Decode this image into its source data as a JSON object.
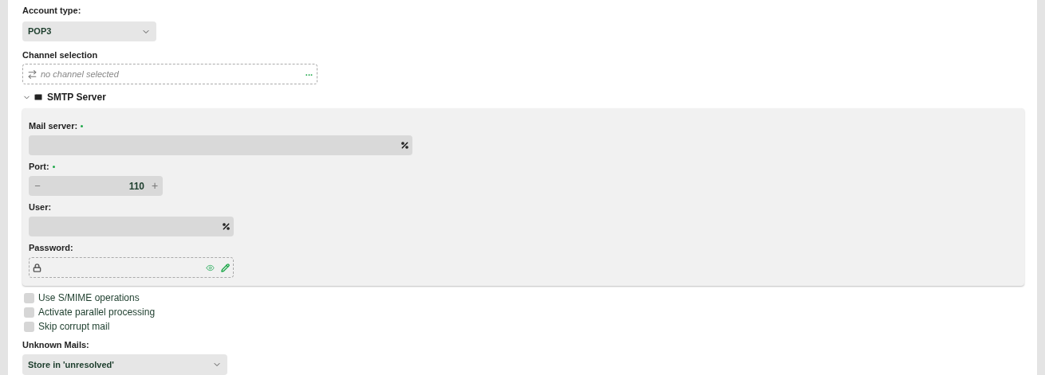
{
  "account_type": {
    "label": "Account type:",
    "value": "POP3"
  },
  "channel_selection": {
    "label": "Channel selection",
    "placeholder": "no channel selected",
    "more": "..."
  },
  "smtp_section": {
    "title": "SMTP Server",
    "expanded": true,
    "fields": [
      {
        "kind": "text",
        "label": "Mail server:",
        "required": true
      },
      {
        "kind": "number",
        "label": "Port:",
        "required": true,
        "value": "110",
        "minus": "−",
        "plus": "+"
      },
      {
        "kind": "text",
        "label": "User:",
        "required": false
      },
      {
        "kind": "password",
        "label": "Password:",
        "required": false
      }
    ]
  },
  "checkboxes": [
    {
      "label": "Use S/MIME operations",
      "checked": false
    },
    {
      "label": "Activate parallel processing",
      "checked": false
    },
    {
      "label": "Skip corrupt mail",
      "checked": false
    }
  ],
  "unknown_mails": {
    "label": "Unknown Mails:",
    "value": "Store in 'unresolved'"
  }
}
